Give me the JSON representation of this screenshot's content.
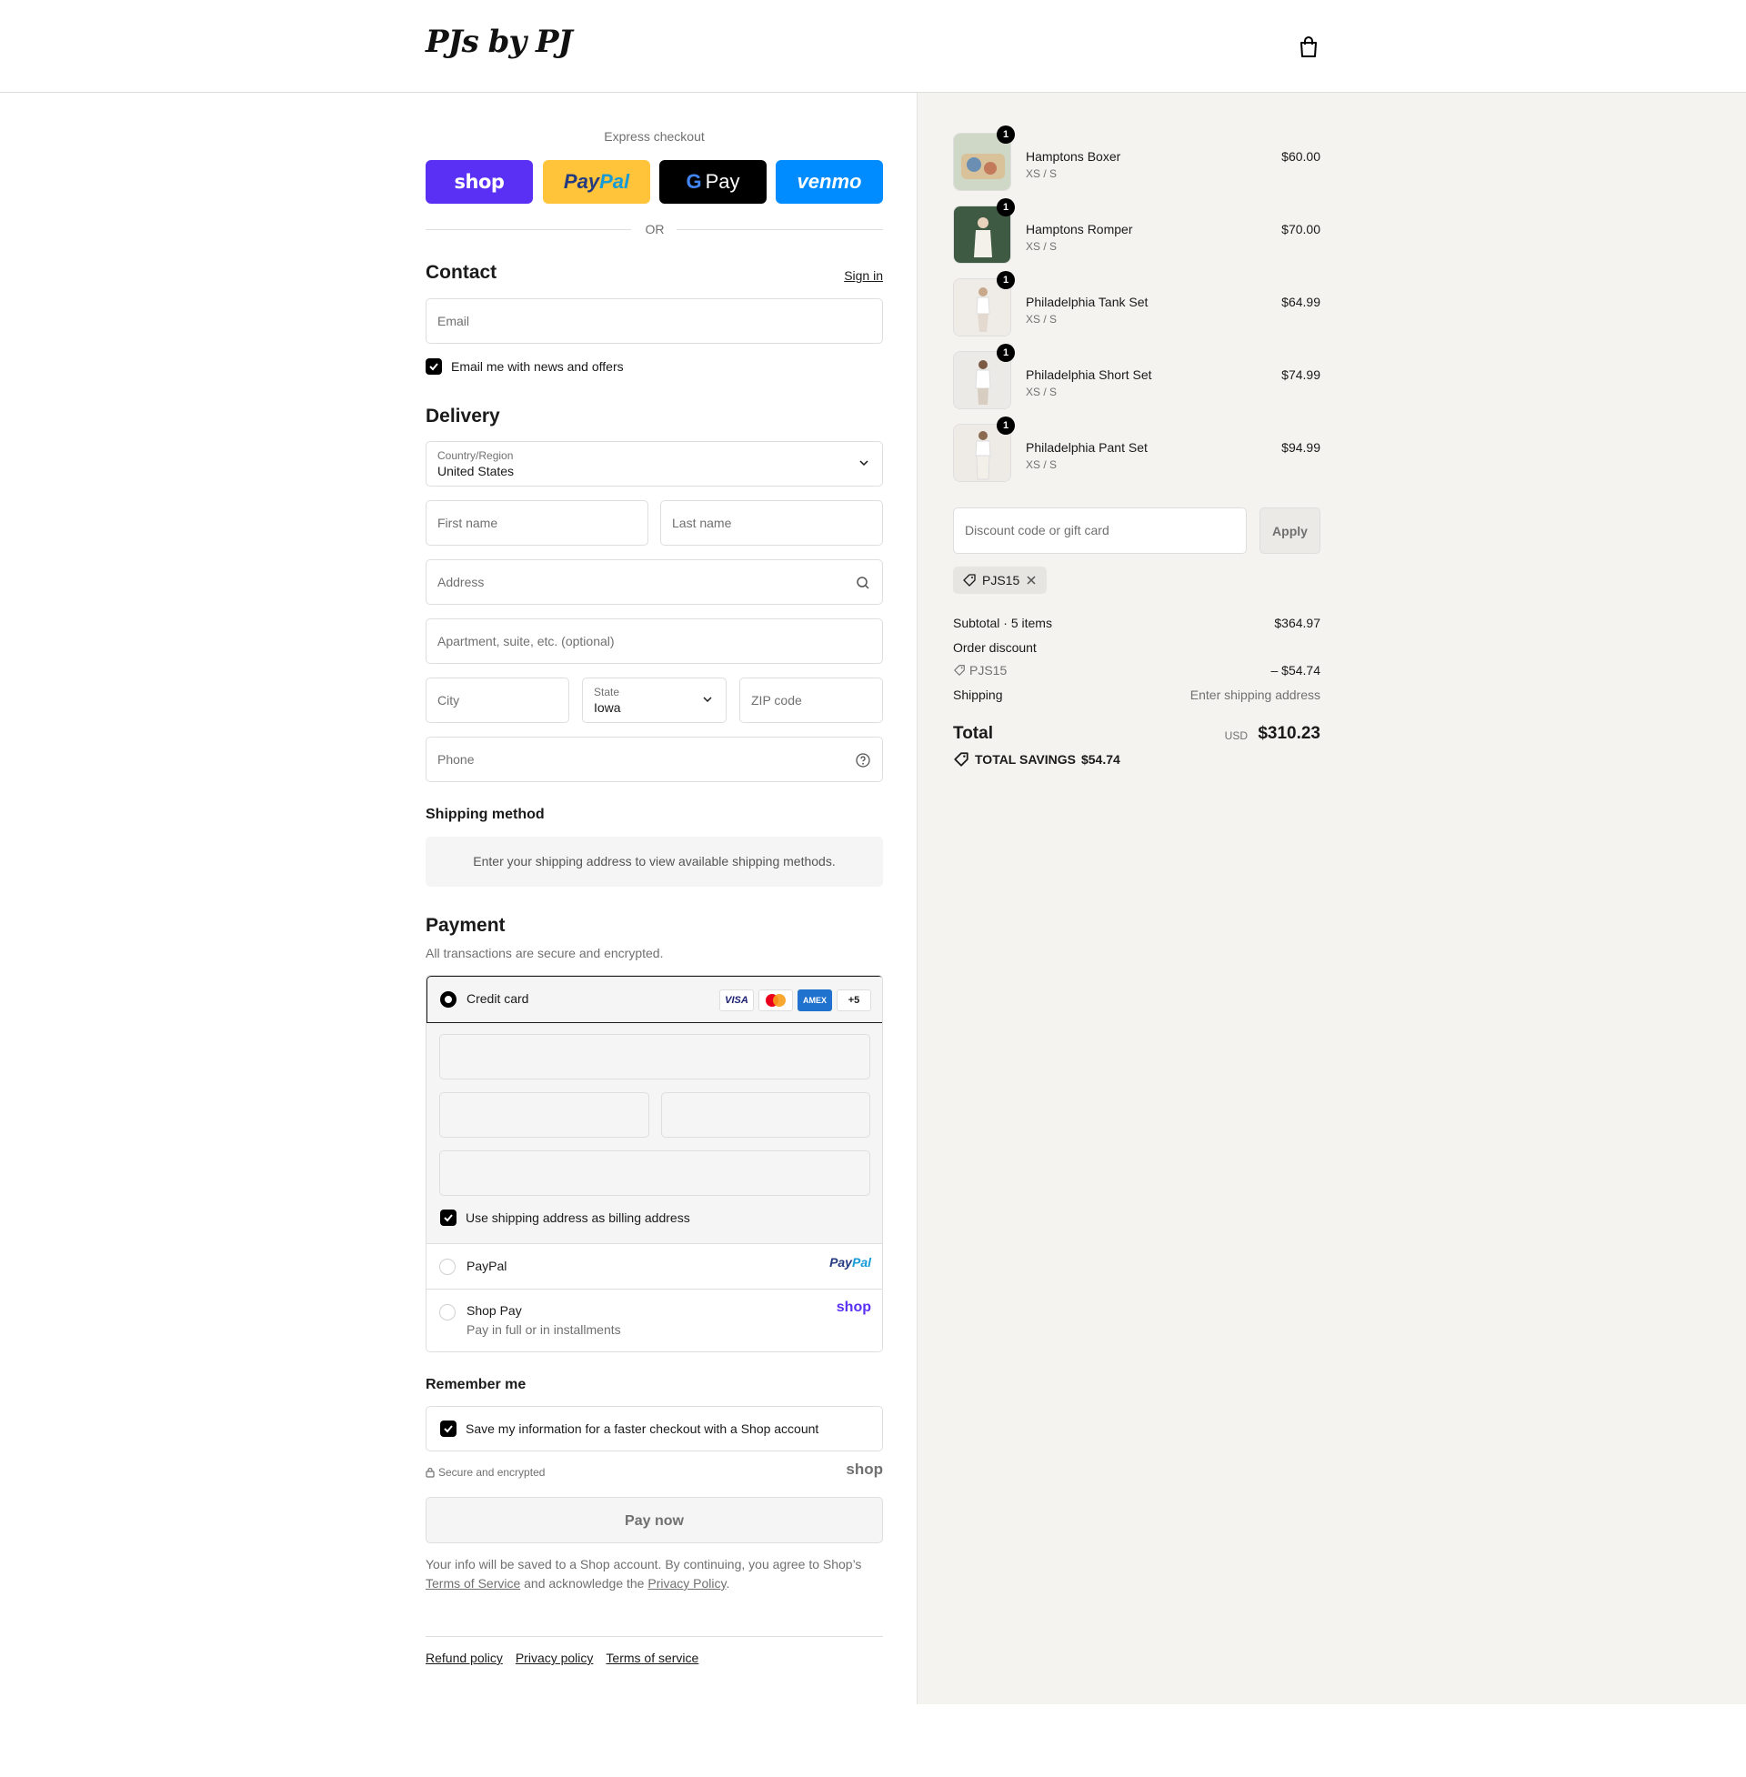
{
  "header": {
    "logo_text": "PJs by PJ",
    "cart_icon": "shopping-bag-icon"
  },
  "express": {
    "title": "Express checkout",
    "shop_label": "shop",
    "paypal_a": "Pay",
    "paypal_b": "Pal",
    "gpay_g": "G",
    "gpay_label": "Pay",
    "venmo_label": "venmo",
    "or_label": "OR"
  },
  "contact": {
    "title": "Contact",
    "sign_in": "Sign in",
    "email_placeholder": "Email",
    "newsletter_label": "Email me with news and offers",
    "newsletter_checked": true
  },
  "delivery": {
    "title": "Delivery",
    "country_label": "Country/Region",
    "country_value": "United States",
    "first_name_placeholder": "First name",
    "last_name_placeholder": "Last name",
    "address_placeholder": "Address",
    "apartment_placeholder": "Apartment, suite, etc. (optional)",
    "city_placeholder": "City",
    "state_label": "State",
    "state_value": "Iowa",
    "zip_placeholder": "ZIP code",
    "phone_placeholder": "Phone"
  },
  "shipping_method": {
    "title": "Shipping method",
    "message": "Enter your shipping address to view available shipping methods."
  },
  "payment": {
    "title": "Payment",
    "subtitle": "All transactions are secure and encrypted.",
    "credit_card_label": "Credit card",
    "card_badges": [
      "VISA",
      "",
      "AMEX",
      "+5"
    ],
    "billing_label": "Use shipping address as billing address",
    "billing_checked": true,
    "paypal_label": "PayPal",
    "paypal_logo_a": "Pay",
    "paypal_logo_b": "Pal",
    "shoppay_label": "Shop Pay",
    "shoppay_sub": "Pay in full or in installments",
    "shoppay_logo": "shop"
  },
  "remember": {
    "title": "Remember me",
    "save_label": "Save my information for a faster checkout with a Shop account",
    "save_checked": true,
    "secure_label": "Secure and encrypted",
    "shop_logo": "shop"
  },
  "pay_now_label": "Pay now",
  "legal": {
    "text_1": "Your info will be saved to a Shop account. By continuing, you agree to Shop’s ",
    "terms_link": "Terms of Service",
    "text_2": " and acknowledge the ",
    "privacy_link": "Privacy Policy",
    "text_3": "."
  },
  "footer": {
    "refund": "Refund policy",
    "privacy": "Privacy policy",
    "terms": "Terms of service"
  },
  "summary": {
    "items": [
      {
        "name": "Hamptons Boxer",
        "variant": "XS / S",
        "price": "$60.00",
        "qty": "1"
      },
      {
        "name": "Hamptons Romper",
        "variant": "XS / S",
        "price": "$70.00",
        "qty": "1"
      },
      {
        "name": "Philadelphia Tank Set",
        "variant": "XS / S",
        "price": "$64.99",
        "qty": "1"
      },
      {
        "name": "Philadelphia Short Set",
        "variant": "XS / S",
        "price": "$74.99",
        "qty": "1"
      },
      {
        "name": "Philadelphia Pant Set",
        "variant": "XS / S",
        "price": "$94.99",
        "qty": "1"
      }
    ],
    "discount_placeholder": "Discount code or gift card",
    "apply_label": "Apply",
    "applied_code": "PJS15",
    "subtotal_label": "Subtotal · 5 items",
    "subtotal_value": "$364.97",
    "order_discount_label": "Order discount",
    "discount_code": "PJS15",
    "discount_value": "– $54.74",
    "shipping_label": "Shipping",
    "shipping_value": "Enter shipping address",
    "total_label": "Total",
    "total_currency": "USD",
    "total_value": "$310.23",
    "savings_label": "TOTAL SAVINGS",
    "savings_value": "$54.74"
  },
  "colors": {
    "shop_purple": "#5a31f4",
    "paypal_yellow": "#ffc439",
    "venmo_blue": "#008cff",
    "sidebar_bg": "#f4f3ef"
  }
}
